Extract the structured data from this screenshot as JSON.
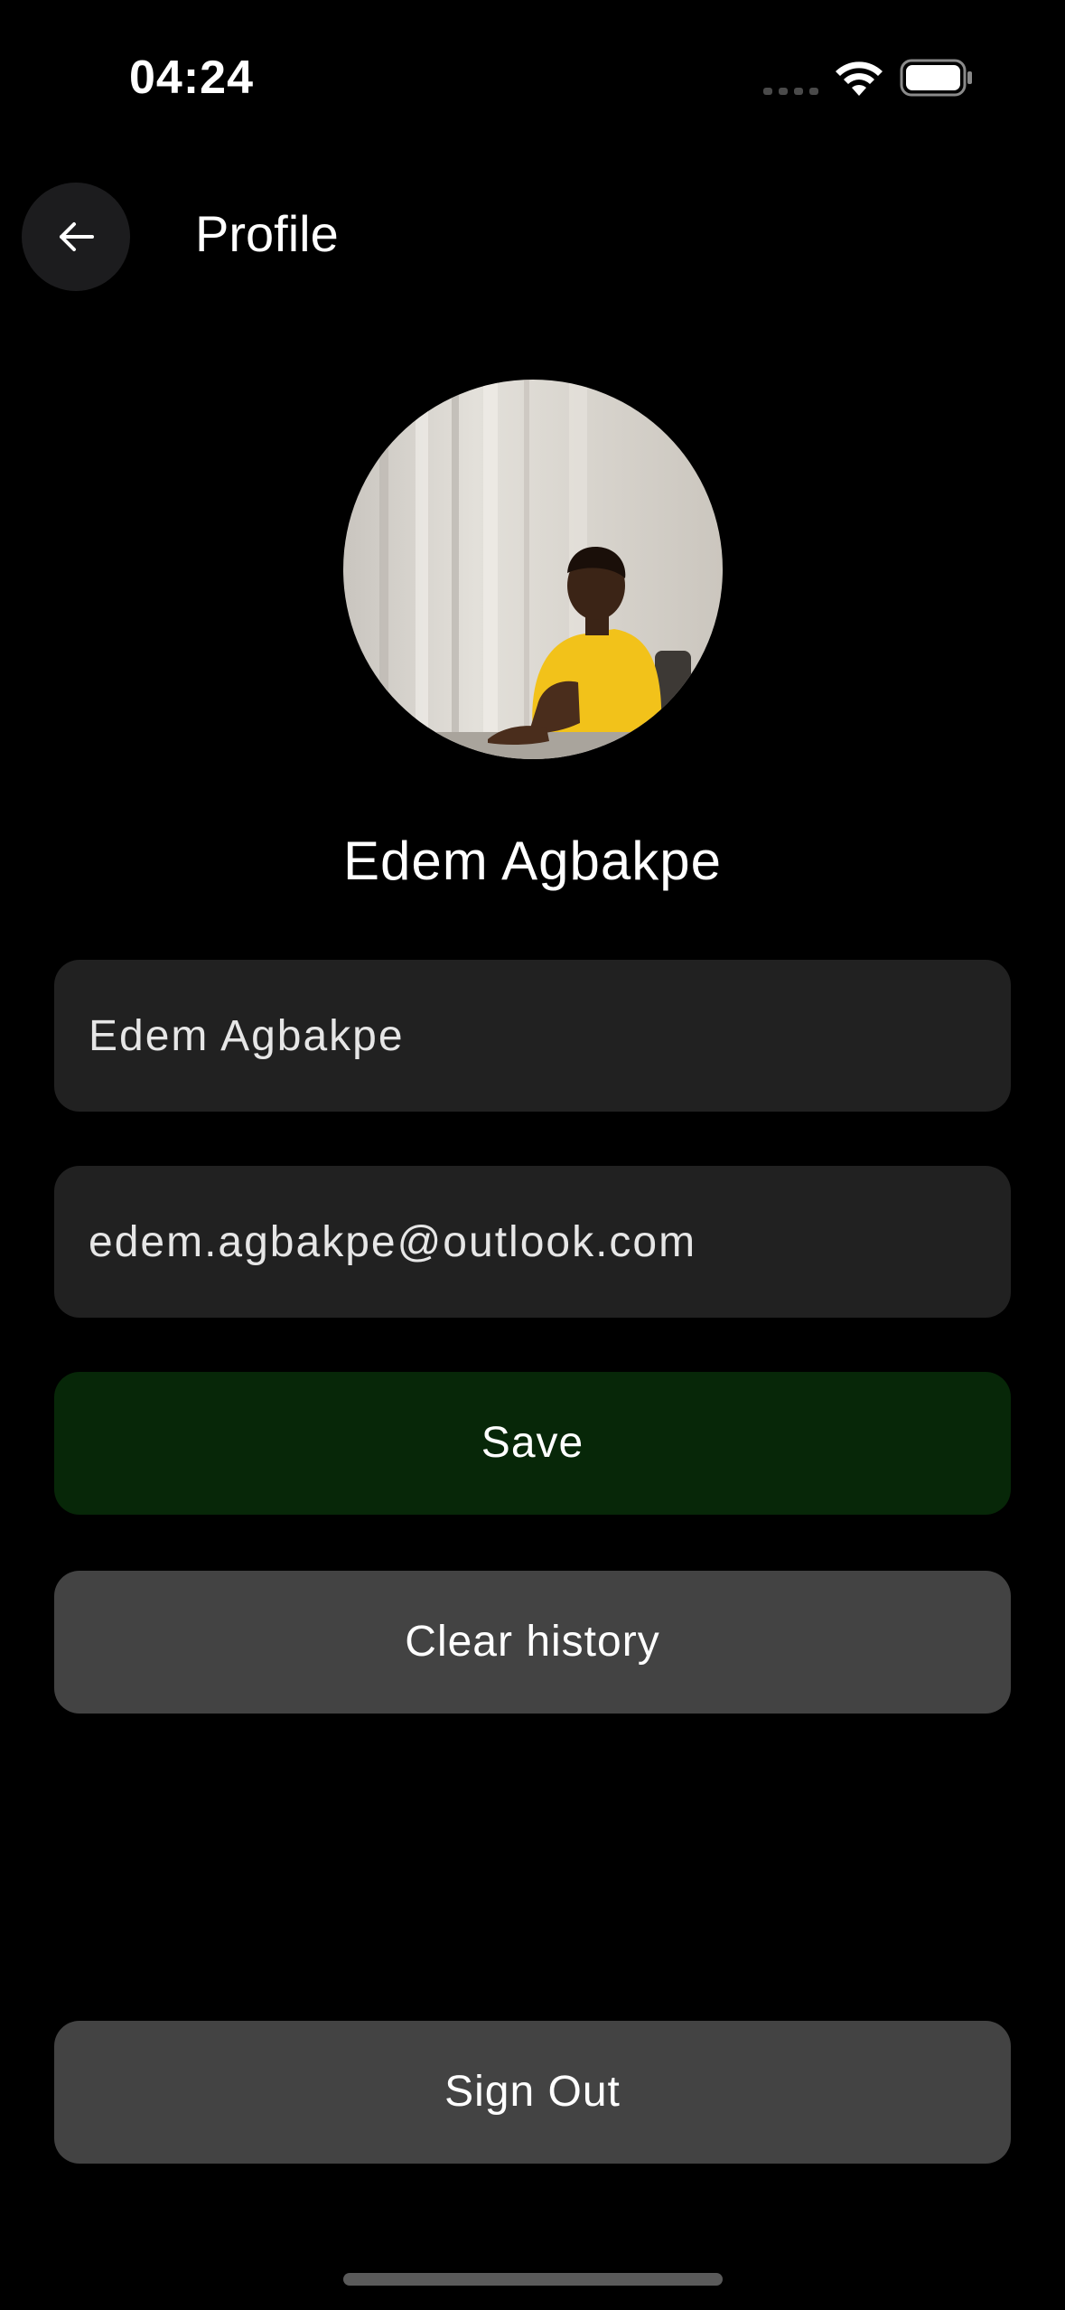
{
  "status_bar": {
    "time": "04:24"
  },
  "header": {
    "title": "Profile",
    "back_icon": "arrow-left-icon"
  },
  "profile": {
    "display_name": "Edem Agbakpe",
    "avatar": "profile-photo"
  },
  "form": {
    "name_value": "Edem Agbakpe",
    "email_value": "edem.agbakpe@outlook.com"
  },
  "actions": {
    "save_label": "Save",
    "clear_history_label": "Clear history",
    "sign_out_label": "Sign Out"
  },
  "colors": {
    "background": "#000000",
    "field_background": "#212121",
    "save_background": "#072708",
    "secondary_button": "#434343",
    "back_button": "#1c1c1e"
  }
}
